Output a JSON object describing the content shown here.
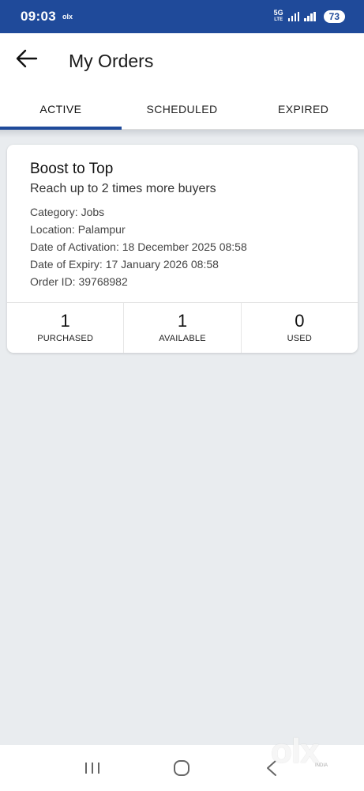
{
  "status_bar": {
    "time": "09:03",
    "app_indicator": "olx",
    "network": "5G",
    "network_sub": "LTE",
    "battery": "73"
  },
  "header": {
    "title": "My Orders",
    "back_icon": "arrow-left-icon"
  },
  "tabs": [
    {
      "label": "ACTIVE",
      "active": true
    },
    {
      "label": "SCHEDULED",
      "active": false
    },
    {
      "label": "EXPIRED",
      "active": false
    }
  ],
  "order": {
    "title": "Boost to Top",
    "subtitle": "Reach up to 2 times more buyers",
    "details": [
      "Category: Jobs",
      "Location: Palampur",
      "Date of Activation: 18 December 2025 08:58",
      "Date of Expiry: 17 January 2026 08:58",
      "Order ID: 39768982"
    ],
    "stats": [
      {
        "value": "1",
        "label": "PURCHASED"
      },
      {
        "value": "1",
        "label": "AVAILABLE"
      },
      {
        "value": "0",
        "label": "USED"
      }
    ]
  },
  "watermark": {
    "text": "olx",
    "sub": "INDIA"
  },
  "nav": {
    "recents_icon": "recents-icon",
    "home_icon": "home-icon",
    "back_icon": "nav-back-icon"
  },
  "colors": {
    "brand": "#1f4a9a",
    "background": "#e9ecef"
  }
}
